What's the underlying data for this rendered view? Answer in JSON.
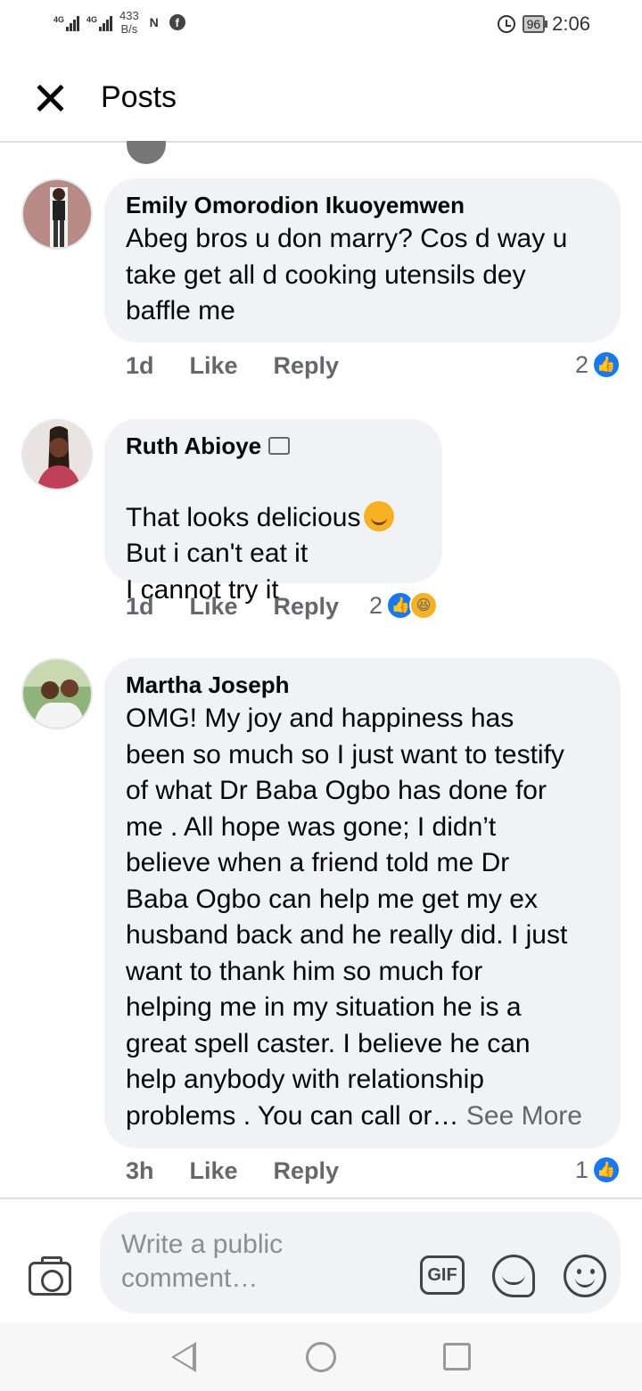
{
  "status_bar": {
    "signal_1": "4G",
    "signal_2": "4G",
    "speed_value": "433",
    "speed_unit": "B/s",
    "icons": [
      "n-icon",
      "facebook-icon"
    ],
    "battery": "96",
    "time": "2:06"
  },
  "header": {
    "title": "Posts"
  },
  "comments": [
    {
      "author": "Emily Omorodion Ikuoyemwen",
      "text": "Abeg bros u don marry? Cos d way u\ntake get all d cooking utensils dey\nbaffle me",
      "time": "1d",
      "like_label": "Like",
      "reply_label": "Reply",
      "reaction_count": "2"
    },
    {
      "author": "Ruth Abioye",
      "text_line1": "That looks delicious",
      "text_rest": "But i can't eat it\nI cannot try it",
      "time": "1d",
      "like_label": "Like",
      "reply_label": "Reply",
      "reaction_count": "2"
    },
    {
      "author": "Martha Joseph",
      "text": "OMG! My joy and happiness has\nbeen so much so I just want to testify\nof what Dr Baba Ogbo has done for\nme . All hope was gone; I didn’t\nbelieve when a friend told me Dr\nBaba Ogbo can help me get my ex\nhusband back and he really did. I just\nwant to thank him so much for\nhelping me in my situation he is a\ngreat spell caster. I believe he can\nhelp anybody with relationship\nproblems . You can call or…",
      "see_more": "See More",
      "time": "3h",
      "like_label": "Like",
      "reply_label": "Reply",
      "reaction_count": "1"
    }
  ],
  "composer": {
    "placeholder": "Write a public comment…",
    "gif_label": "GIF"
  },
  "colors": {
    "bubble": "#f0f2f5",
    "meta": "#65676b",
    "like_blue": "#1877f2"
  }
}
